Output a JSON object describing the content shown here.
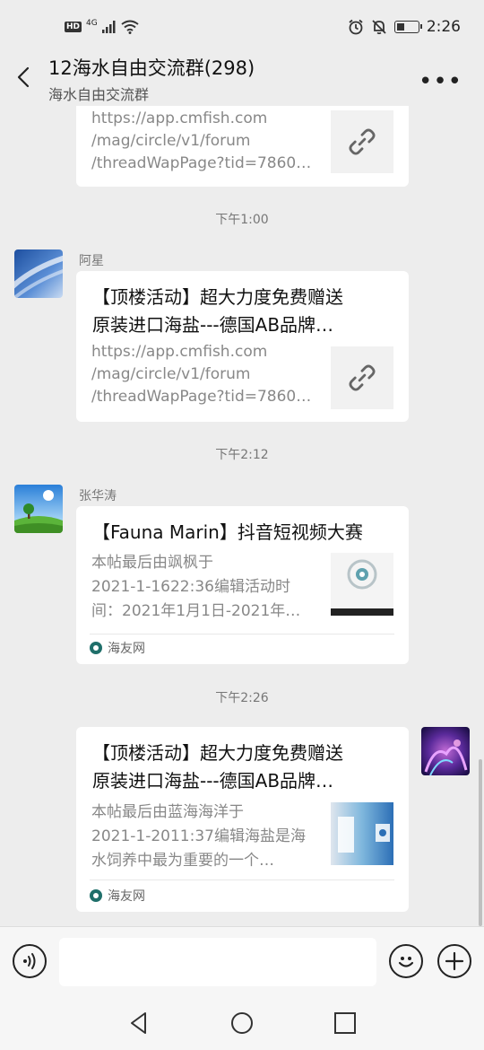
{
  "status_bar": {
    "hd": "HD",
    "network": "4G",
    "time": "2:26"
  },
  "header": {
    "title": "12海水自由交流群(298)",
    "subtitle": "海水自由交流群",
    "more": "•••"
  },
  "messages": [
    {
      "type": "link_card_partial",
      "url_lines": [
        "https://app.cmfish.com",
        "/mag/circle/v1/forum",
        "/threadWapPage?tid=7860…"
      ]
    },
    {
      "type": "time",
      "text": "下午1:00"
    },
    {
      "type": "link_card",
      "sender": "阿星",
      "title_lines": [
        "【顶楼活动】超大力度免费赠送",
        "原装进口海盐---德国AB品牌…"
      ],
      "url_lines": [
        "https://app.cmfish.com",
        "/mag/circle/v1/forum",
        "/threadWapPage?tid=7860…"
      ]
    },
    {
      "type": "time",
      "text": "下午2:12"
    },
    {
      "type": "article_card",
      "sender": "张华涛",
      "title_lines": [
        "【Fauna Marin】抖音短视频大赛"
      ],
      "desc_lines": [
        "本帖最后由飒枫于",
        "2021-1-1622:36编辑活动时",
        "间：2021年1月1日-2021年…"
      ],
      "source": "海友网"
    },
    {
      "type": "time",
      "text": "下午2:26"
    },
    {
      "type": "article_card_self",
      "title_lines": [
        "【顶楼活动】超大力度免费赠送",
        "原装进口海盐---德国AB品牌…"
      ],
      "desc_lines": [
        "本帖最后由蓝海海洋于",
        "2021-1-2011:37编辑海盐是海",
        "水饲养中最为重要的一个…"
      ],
      "source": "海友网"
    }
  ],
  "input": {
    "placeholder": ""
  },
  "colors": {
    "background": "#ededed",
    "card": "#ffffff",
    "text_gray": "#888888"
  }
}
